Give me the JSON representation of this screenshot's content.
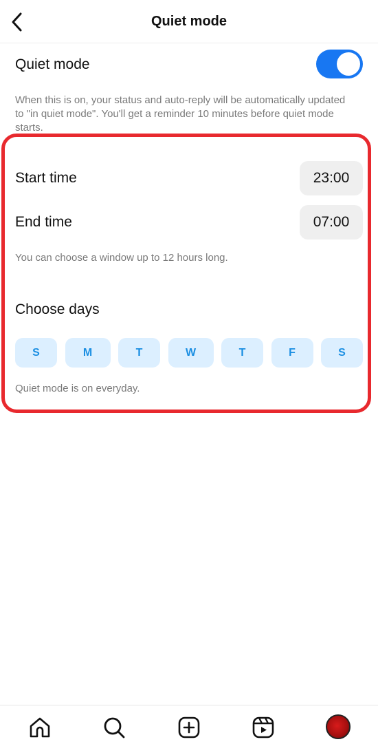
{
  "header": {
    "title": "Quiet mode"
  },
  "quiet_mode": {
    "label": "Quiet mode",
    "toggle_on": true,
    "description": "When this is on, your status and auto-reply will be automatically updated to \"in quiet mode\". You'll get a reminder 10 minutes before quiet mode starts."
  },
  "schedule": {
    "start_label": "Start time",
    "start_value": "23:00",
    "end_label": "End time",
    "end_value": "07:00",
    "window_note": "You can choose a window up to 12 hours long.",
    "choose_days_label": "Choose days",
    "days": [
      "S",
      "M",
      "T",
      "W",
      "T",
      "F",
      "S"
    ],
    "days_note": "Quiet mode is on everyday."
  },
  "colors": {
    "accent": "#1877f2",
    "highlight": "#e8292e",
    "day_bg": "#dcefff",
    "day_text": "#1a8ee2"
  },
  "bottom_nav": {
    "items": [
      "home-icon",
      "search-icon",
      "create-icon",
      "reels-icon",
      "profile-avatar"
    ]
  }
}
